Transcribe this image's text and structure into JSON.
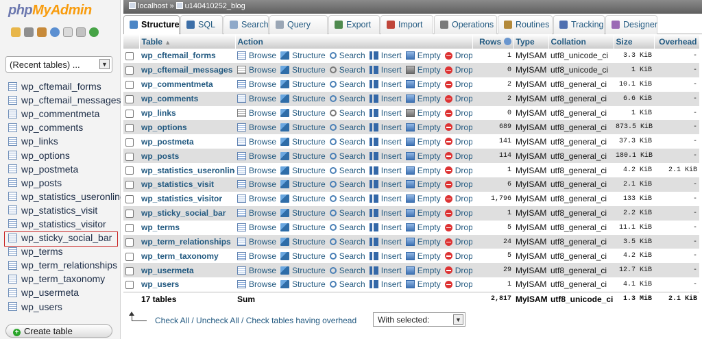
{
  "logo": {
    "part1": "php",
    "part2": "MyAdmin"
  },
  "nav": {
    "recent_label": "(Recent tables) ...",
    "tables": [
      "wp_cftemail_forms",
      "wp_cftemail_messages",
      "wp_commentmeta",
      "wp_comments",
      "wp_links",
      "wp_options",
      "wp_postmeta",
      "wp_posts",
      "wp_statistics_useronline",
      "wp_statistics_visit",
      "wp_statistics_visitor",
      "wp_sticky_social_bar",
      "wp_terms",
      "wp_term_relationships",
      "wp_term_taxonomy",
      "wp_usermeta",
      "wp_users"
    ],
    "selected_table": "wp_sticky_social_bar",
    "create_label": "Create table"
  },
  "breadcrumb": {
    "server": "localhost",
    "separator": "»",
    "database": "u140410252_blog"
  },
  "tabs": [
    "Structure",
    "SQL",
    "Search",
    "Query",
    "Export",
    "Import",
    "Operations",
    "Routines",
    "Tracking",
    "Designer"
  ],
  "active_tab": "Structure",
  "columns": {
    "table": "Table",
    "action": "Action",
    "rows": "Rows",
    "type": "Type",
    "collation": "Collation",
    "size": "Size",
    "overhead": "Overhead"
  },
  "actions": [
    "Browse",
    "Structure",
    "Search",
    "Insert",
    "Empty",
    "Drop"
  ],
  "rows": [
    {
      "name": "wp_cftemail_forms",
      "rows": "1",
      "type": "MyISAM",
      "collation": "utf8_unicode_ci",
      "size": "3.3 KiB",
      "overhead": "-"
    },
    {
      "name": "wp_cftemail_messages",
      "rows": "0",
      "type": "MyISAM",
      "collation": "utf8_unicode_ci",
      "size": "1 KiB",
      "overhead": "-"
    },
    {
      "name": "wp_commentmeta",
      "rows": "2",
      "type": "MyISAM",
      "collation": "utf8_general_ci",
      "size": "10.1 KiB",
      "overhead": "-"
    },
    {
      "name": "wp_comments",
      "rows": "2",
      "type": "MyISAM",
      "collation": "utf8_general_ci",
      "size": "6.6 KiB",
      "overhead": "-"
    },
    {
      "name": "wp_links",
      "rows": "0",
      "type": "MyISAM",
      "collation": "utf8_general_ci",
      "size": "1 KiB",
      "overhead": "-"
    },
    {
      "name": "wp_options",
      "rows": "689",
      "type": "MyISAM",
      "collation": "utf8_general_ci",
      "size": "873.5 KiB",
      "overhead": "-"
    },
    {
      "name": "wp_postmeta",
      "rows": "141",
      "type": "MyISAM",
      "collation": "utf8_general_ci",
      "size": "37.3 KiB",
      "overhead": "-"
    },
    {
      "name": "wp_posts",
      "rows": "114",
      "type": "MyISAM",
      "collation": "utf8_general_ci",
      "size": "180.1 KiB",
      "overhead": "-"
    },
    {
      "name": "wp_statistics_useronline",
      "rows": "1",
      "type": "MyISAM",
      "collation": "utf8_general_ci",
      "size": "4.2 KiB",
      "overhead": "2.1 KiB"
    },
    {
      "name": "wp_statistics_visit",
      "rows": "6",
      "type": "MyISAM",
      "collation": "utf8_general_ci",
      "size": "2.1 KiB",
      "overhead": "-"
    },
    {
      "name": "wp_statistics_visitor",
      "rows": "1,796",
      "type": "MyISAM",
      "collation": "utf8_general_ci",
      "size": "133 KiB",
      "overhead": "-"
    },
    {
      "name": "wp_sticky_social_bar",
      "rows": "1",
      "type": "MyISAM",
      "collation": "utf8_general_ci",
      "size": "2.2 KiB",
      "overhead": "-"
    },
    {
      "name": "wp_terms",
      "rows": "5",
      "type": "MyISAM",
      "collation": "utf8_general_ci",
      "size": "11.1 KiB",
      "overhead": "-"
    },
    {
      "name": "wp_term_relationships",
      "rows": "24",
      "type": "MyISAM",
      "collation": "utf8_general_ci",
      "size": "3.5 KiB",
      "overhead": "-"
    },
    {
      "name": "wp_term_taxonomy",
      "rows": "5",
      "type": "MyISAM",
      "collation": "utf8_general_ci",
      "size": "4.2 KiB",
      "overhead": "-"
    },
    {
      "name": "wp_usermeta",
      "rows": "29",
      "type": "MyISAM",
      "collation": "utf8_general_ci",
      "size": "12.7 KiB",
      "overhead": "-"
    },
    {
      "name": "wp_users",
      "rows": "1",
      "type": "MyISAM",
      "collation": "utf8_general_ci",
      "size": "4.1 KiB",
      "overhead": "-"
    }
  ],
  "summary": {
    "tables": "17 tables",
    "label": "Sum",
    "rows": "2,817",
    "type": "MyISAM",
    "collation": "utf8_unicode_ci",
    "size": "1.3 MiB",
    "overhead": "2.1 KiB"
  },
  "footer": {
    "check_links": "Check All / Uncheck All / Check tables having overhead",
    "with_selected": "With selected:"
  },
  "colors": {
    "link": "#235a81",
    "row_alt": "#dfdfdf",
    "logo_php": "#6c78af",
    "logo_myadmin": "#f89c0e",
    "highlight_border": "#c82020"
  }
}
